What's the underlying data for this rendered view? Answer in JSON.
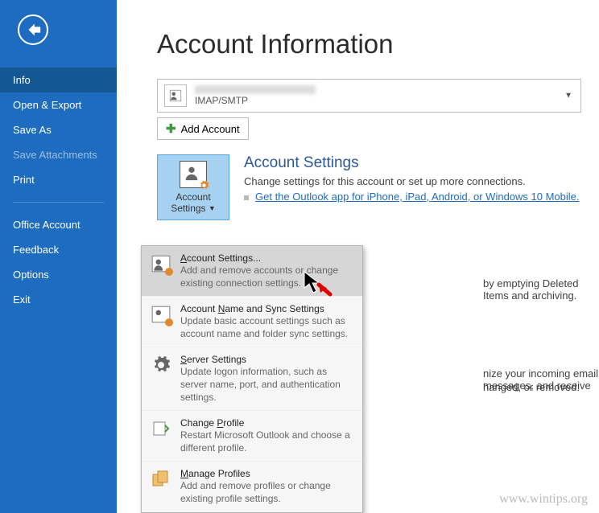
{
  "sidebar": {
    "items": [
      {
        "label": "Info"
      },
      {
        "label": "Open & Export"
      },
      {
        "label": "Save As"
      },
      {
        "label": "Save Attachments"
      },
      {
        "label": "Print"
      },
      {
        "label": "Office Account"
      },
      {
        "label": "Feedback"
      },
      {
        "label": "Options"
      },
      {
        "label": "Exit"
      }
    ]
  },
  "page": {
    "title": "Account Information"
  },
  "account_select": {
    "protocol": "IMAP/SMTP"
  },
  "add_account_label": "Add Account",
  "account_settings": {
    "button_line1": "Account",
    "button_line2": "Settings",
    "heading": "Account Settings",
    "desc": "Change settings for this account or set up more connections.",
    "link": "Get the Outlook app for iPhone, iPad, Android, or Windows 10 Mobile."
  },
  "dropdown": [
    {
      "title_pre": "",
      "u": "A",
      "title_post": "ccount Settings...",
      "desc": "Add and remove accounts or change existing connection settings."
    },
    {
      "title_pre": "Account ",
      "u": "N",
      "title_post": "ame and Sync Settings",
      "desc": "Update basic account settings such as account name and folder sync settings."
    },
    {
      "title_pre": "",
      "u": "S",
      "title_post": "erver Settings",
      "desc": "Update logon information, such as server name, port, and authentication settings."
    },
    {
      "title_pre": "Change ",
      "u": "P",
      "title_post": "rofile",
      "desc": "Restart Microsoft Outlook and choose a different profile."
    },
    {
      "title_pre": "",
      "u": "M",
      "title_post": "anage Profiles",
      "desc": "Add and remove profiles or change existing profile settings."
    }
  ],
  "behind": {
    "line1": "by emptying Deleted Items and archiving.",
    "line2a": "nize your incoming email messages, and receive",
    "line2b": "hanged, or removed."
  },
  "watermark": "www.wintips.org"
}
